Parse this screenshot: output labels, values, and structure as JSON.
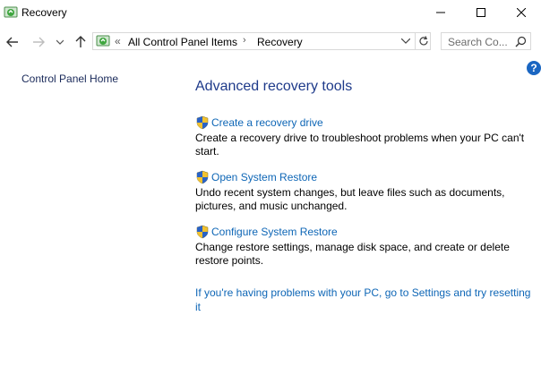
{
  "window": {
    "title": "Recovery"
  },
  "nav": {
    "breadcrumb": [
      "All Control Panel Items",
      "Recovery"
    ],
    "overflow_chevron": "«",
    "search_placeholder": "Search Co..."
  },
  "sidebar": {
    "home_link": "Control Panel Home"
  },
  "main": {
    "heading": "Advanced recovery tools",
    "tools": [
      {
        "label": "Create a recovery drive",
        "description": "Create a recovery drive to troubleshoot problems when your PC can't start."
      },
      {
        "label": "Open System Restore",
        "description": "Undo recent system changes, but leave files such as documents, pictures, and music unchanged."
      },
      {
        "label": "Configure System Restore",
        "description": "Change restore settings, manage disk space, and create or delete restore points."
      }
    ],
    "reset_link": "If you're having problems with your PC, go to Settings and try resetting it"
  },
  "help": {
    "glyph": "?"
  },
  "colors": {
    "link": "#0e66b6",
    "heading": "#1e3a8a",
    "help": "#1a66c2"
  }
}
